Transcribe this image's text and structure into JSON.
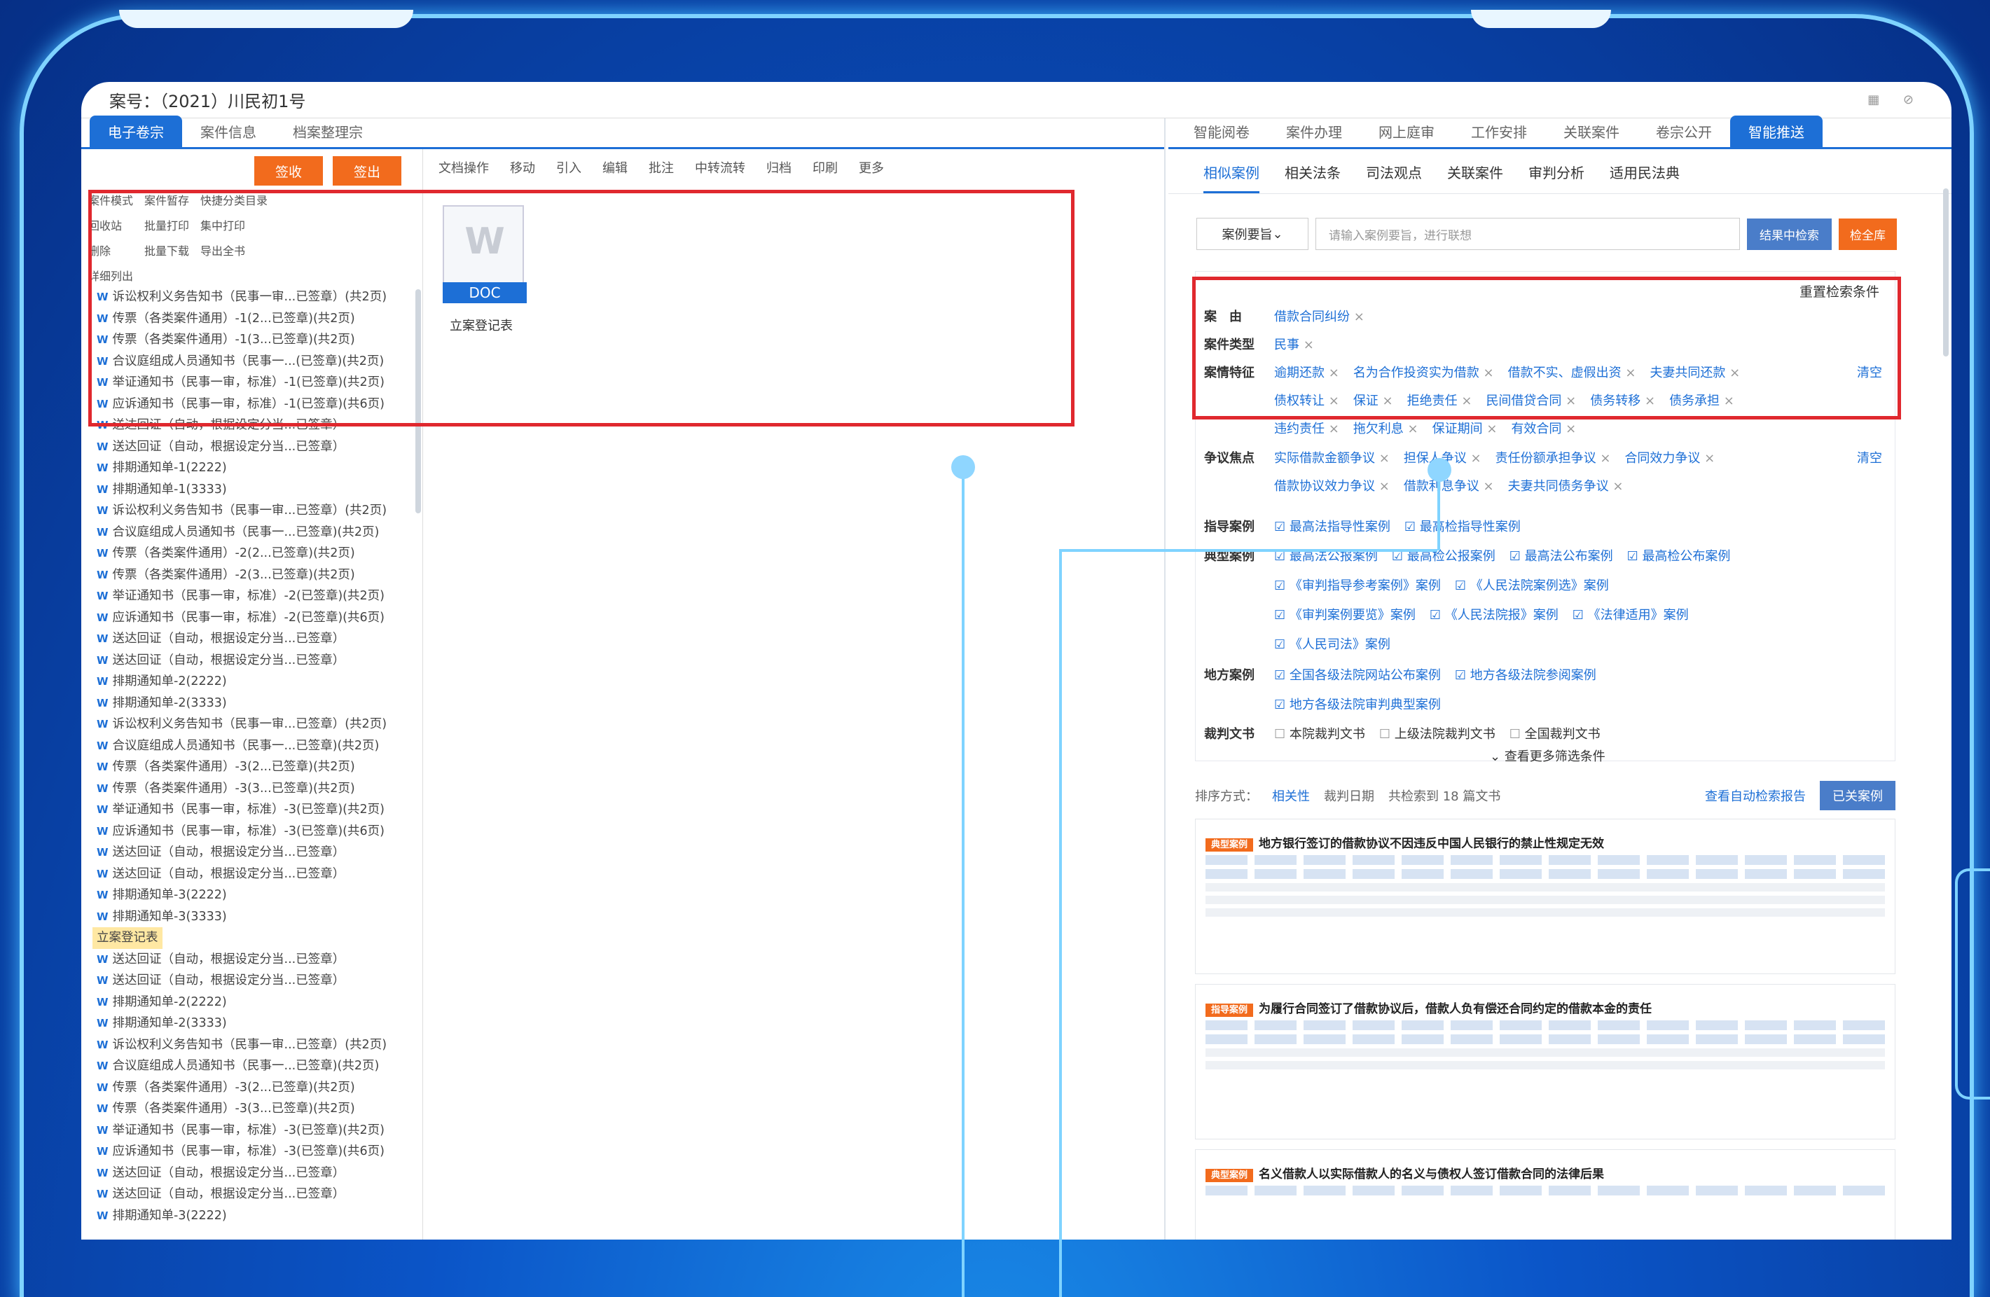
{
  "title": "案号：（2021）川民初1号",
  "left_tabs": [
    "电子卷宗",
    "案件信息",
    "档案整理宗"
  ],
  "left_buttons": {
    "sign": "签收",
    "return": "签出"
  },
  "tools": [
    "案件模式",
    "案件暂存",
    "快捷分类目录",
    "回收站",
    "批量打印",
    "集中打印",
    "删除",
    "批量下载",
    "导出全书",
    "详细列出"
  ],
  "doc_toolbar": [
    "文档操作",
    "移动",
    "引入",
    "编辑",
    "批注",
    "中转流转",
    "归档",
    "印刷",
    "更多"
  ],
  "files": [
    "诉讼权利义务告知书（民事一审...已签章）(共2页)",
    "传票（各类案件通用）-1(2...已签章)(共2页)",
    "传票（各类案件通用）-1(3...已签章)(共2页)",
    "合议庭组成人员通知书（民事一...(已签章)(共2页)",
    "举证通知书（民事一审，标准）-1(已签章)(共2页)",
    "应诉通知书（民事一审，标准）-1(已签章)(共6页)",
    "送达回证（自动，根据设定分当...已签章）",
    "送达回证（自动，根据设定分当...已签章）",
    "排期通知单-1(2222)",
    "排期通知单-1(3333)",
    "诉讼权利义务告知书（民事一审...已签章）(共2页)",
    "合议庭组成人员通知书（民事一...已签章)(共2页)",
    "传票（各类案件通用）-2(2...已签章)(共2页)",
    "传票（各类案件通用）-2(3...已签章)(共2页)",
    "举证通知书（民事一审，标准）-2(已签章)(共2页)",
    "应诉通知书（民事一审，标准）-2(已签章)(共6页)",
    "送达回证（自动，根据设定分当...已签章）",
    "送达回证（自动，根据设定分当...已签章）",
    "排期通知单-2(2222)",
    "排期通知单-2(3333)",
    "诉讼权利义务告知书（民事一审...已签章）(共2页)",
    "合议庭组成人员通知书（民事一...已签章)(共2页)",
    "传票（各类案件通用）-3(2...已签章)(共2页)",
    "传票（各类案件通用）-3(3...已签章)(共2页)",
    "举证通知书（民事一审，标准）-3(已签章)(共2页)",
    "应诉通知书（民事一审，标准）-3(已签章)(共6页)",
    "送达回证（自动，根据设定分当...已签章）",
    "送达回证（自动，根据设定分当...已签章）",
    "排期通知单-3(2222)",
    "排期通知单-3(3333)"
  ],
  "folder": "立案登记表",
  "files2": [
    "送达回证（自动，根据设定分当...已签章）",
    "送达回证（自动，根据设定分当...已签章）",
    "排期通知单-2(2222)",
    "排期通知单-2(3333)",
    "诉讼权利义务告知书（民事一审...已签章）(共2页)",
    "合议庭组成人员通知书（民事一...已签章)(共2页)",
    "传票（各类案件通用）-3(2...已签章)(共2页)",
    "传票（各类案件通用）-3(3...已签章)(共2页)",
    "举证通知书（民事一审，标准）-3(已签章)(共2页)",
    "应诉通知书（民事一审，标准）-3(已签章)(共6页)",
    "送达回证（自动，根据设定分当...已签章）",
    "送达回证（自动，根据设定分当...已签章）",
    "排期通知单-3(2222)"
  ],
  "doc": {
    "badge": "DOC",
    "caption": "立案登记表"
  },
  "right_tabs": [
    "智能阅卷",
    "案件办理",
    "网上庭审",
    "工作安排",
    "关联案件",
    "卷宗公开",
    "智能推送"
  ],
  "sub_tabs": [
    "相似案例",
    "相关法条",
    "司法观点",
    "关联案件",
    "审判分析",
    "适用民法典"
  ],
  "search": {
    "select": "案例要旨",
    "placeholder": "请输入案例要旨，进行联想",
    "btn1": "结果中检索",
    "btn2": "检全库"
  },
  "filter_title": "重置检索条件",
  "case_cause": {
    "label": "案　由",
    "chips": [
      "借款合同纠纷"
    ]
  },
  "case_type": {
    "label": "案件类型",
    "chips": [
      "民事"
    ]
  },
  "case_feat": {
    "label": "案情特征",
    "chips1": [
      "逾期还款",
      "名为合作投资实为借款",
      "借款不实、虚假出资",
      "夫妻共同还款"
    ],
    "chips2": [
      "债权转让",
      "保证",
      "拒绝责任",
      "民间借贷合同",
      "债务转移",
      "债务承担"
    ],
    "chips3": [
      "违约责任",
      "拖欠利息",
      "保证期间",
      "有效合同"
    ],
    "clear": "清空"
  },
  "dispute": {
    "label": "争议焦点",
    "chips1": [
      "实际借款金额争议",
      "担保人争议",
      "责任份额承担争议",
      "合同效力争议"
    ],
    "chips2": [
      "借款协议效力争议",
      "借款利息争议",
      "夫妻共同债务争议"
    ],
    "clear": "清空"
  },
  "guide": {
    "label": "指导案例",
    "items": [
      "最高法指导性案例",
      "最高检指导性案例"
    ]
  },
  "typical": {
    "label": "典型案例",
    "r1": [
      "最高法公报案例",
      "最高检公报案例",
      "最高法公布案例",
      "最高检公布案例"
    ],
    "r2": [
      "《审判指导参考案例》案例",
      "《人民法院案例选》案例"
    ],
    "r3": [
      "《审判案例要览》案例",
      "《人民法院报》案例",
      "《法律适用》案例"
    ],
    "r4": [
      "《人民司法》案例"
    ]
  },
  "local": {
    "label": "地方案例",
    "r1": [
      "全国各级法院网站公布案例",
      "地方各级法院参阅案例"
    ],
    "r2": [
      "地方各级法院审判典型案例"
    ]
  },
  "judgment": {
    "label": "裁判文书",
    "items": [
      "本院裁判文书",
      "上级法院裁判文书",
      "全国裁判文书"
    ]
  },
  "more": "查看更多筛选条件",
  "sort": {
    "label": "排序方式：",
    "opt1": "相关性",
    "opt2": "裁判日期",
    "count": "共检索到 18 篇文书",
    "link": "查看自动检索报告",
    "btn": "已关案例"
  },
  "results": [
    {
      "tag": "典型案例",
      "title": "地方银行签订的借款协议不因违反中国人民银行的禁止性规定无效"
    },
    {
      "tag": "指导案例",
      "title": "为履行合同签订了借款协议后，借款人负有偿还合同约定的借款本金的责任"
    },
    {
      "tag": "典型案例",
      "title": "名义借款人以实际借款人的名义与债权人签订借款合同的法律后果"
    }
  ],
  "colors": {
    "accent": "#1d6fd6",
    "orange": "#f26b1d",
    "red": "#e0282e",
    "frame": "#7fd3ff"
  }
}
